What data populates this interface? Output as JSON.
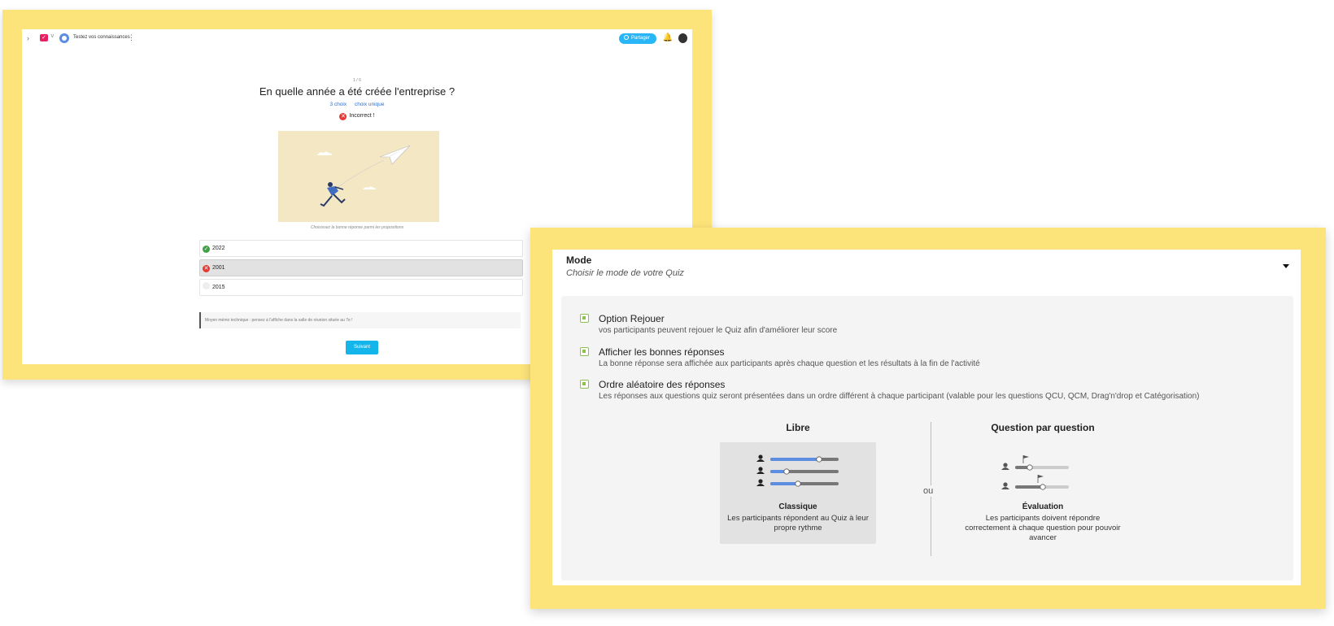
{
  "quiz_preview": {
    "topbar": {
      "back_icon": "›",
      "logo_caret": "˅",
      "quiz_title": "Testez vos connaissances",
      "menu_icon": "⋮",
      "share_label": "Partager",
      "bell_icon": "🔔"
    },
    "question": {
      "counter": "1 / 6",
      "title": "En quelle année a été créée l'entreprise ?",
      "choice_count": "3 choix",
      "choice_type": "choix unique",
      "status": "Incorrect !"
    },
    "caption": "Choisissez la bonne réponse parmi les propositions",
    "answers": [
      {
        "label": "2022",
        "state": "correct"
      },
      {
        "label": "2001",
        "state": "wrong-selected"
      },
      {
        "label": "2015",
        "state": "neutral"
      }
    ],
    "hint": "Moyen mémo technique : pensez à l'affiche dans la salle de réunion située au 7e !",
    "next_label": "Suivant",
    "colors": {
      "frame": "#fde47a",
      "accent": "#14b5ea",
      "wrong": "#e53935",
      "correct": "#43a047"
    }
  },
  "mode_settings": {
    "title": "Mode",
    "subtitle": "Choisir le mode de votre Quiz",
    "options": [
      {
        "label": "Option Rejouer",
        "description": "vos participants peuvent rejouer le Quiz afin d'améliorer leur score",
        "checked": true
      },
      {
        "label": "Afficher les bonnes réponses",
        "description": "La bonne réponse sera affichée aux participants après chaque question et les résultats à la fin de l'activité",
        "checked": true
      },
      {
        "label": "Ordre aléatoire des réponses",
        "description": "Les réponses aux questions quiz seront présentées dans un ordre différent à chaque participant (valable pour les questions QCU, QCM, Drag'n'drop et Catégorisation)",
        "checked": true
      }
    ],
    "modes": [
      {
        "header": "Libre",
        "name": "Classique",
        "description": "Les participants répondent au Quiz à leur propre rythme",
        "selected": true
      },
      {
        "header": "Question par question",
        "name": "Évaluation",
        "description": "Les participants doivent répondre correctement à chaque question pour pouvoir avancer",
        "selected": false
      }
    ],
    "or_label": "ou",
    "colors": {
      "check": "#8bc34a",
      "slider": "#5c8de0"
    }
  }
}
